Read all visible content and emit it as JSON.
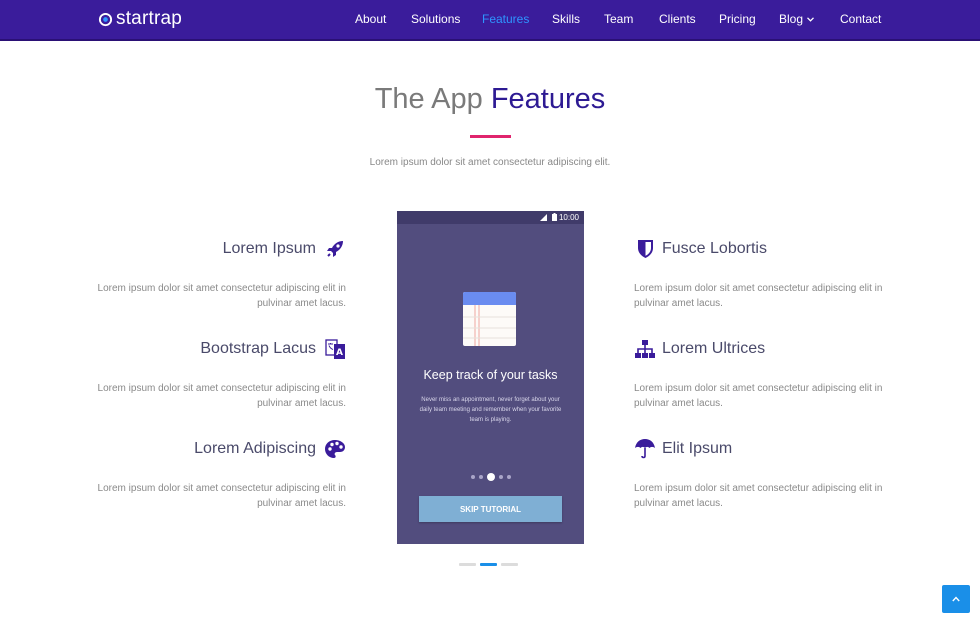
{
  "brand": {
    "name": "startrap"
  },
  "nav": {
    "items": [
      {
        "label": "About",
        "active": false
      },
      {
        "label": "Solutions",
        "active": false
      },
      {
        "label": "Features",
        "active": true
      },
      {
        "label": "Skills",
        "active": false
      },
      {
        "label": "Team",
        "active": false
      },
      {
        "label": "Clients",
        "active": false
      },
      {
        "label": "Pricing",
        "active": false
      },
      {
        "label": "Blog",
        "active": false,
        "dropdown": true
      },
      {
        "label": "Contact",
        "active": false
      }
    ]
  },
  "section": {
    "title_light": "The App",
    "title_strong": "Features",
    "subtitle": "Lorem ipsum dolor sit amet consectetur adipiscing elit."
  },
  "features_left": [
    {
      "title": "Lorem Ipsum",
      "icon": "rocket-icon",
      "desc": "Lorem ipsum dolor sit amet consectetur adipiscing elit in pulvinar amet lacus."
    },
    {
      "title": "Bootstrap Lacus",
      "icon": "translate-icon",
      "desc": "Lorem ipsum dolor sit amet consectetur adipiscing elit in pulvinar amet lacus."
    },
    {
      "title": "Lorem Adipiscing",
      "icon": "palette-icon",
      "desc": "Lorem ipsum dolor sit amet consectetur adipiscing elit in pulvinar amet lacus."
    }
  ],
  "features_right": [
    {
      "title": "Fusce Lobortis",
      "icon": "shield-icon",
      "desc": "Lorem ipsum dolor sit amet consectetur adipiscing elit in pulvinar amet lacus."
    },
    {
      "title": "Lorem Ultrices",
      "icon": "sitemap-icon",
      "desc": "Lorem ipsum dolor sit amet consectetur adipiscing elit in pulvinar amet lacus."
    },
    {
      "title": "Elit Ipsum",
      "icon": "umbrella-icon",
      "desc": "Lorem ipsum dolor sit amet consectetur adipiscing elit in pulvinar amet lacus."
    }
  ],
  "phone": {
    "time": "10:00",
    "title": "Keep track of your tasks",
    "text": "Never miss an appointment, never forget about your daily team meeting and remember when your favorite team is playing.",
    "button": "SKIP TUTORIAL",
    "pages": 5,
    "current_page": 3
  },
  "carousel": {
    "slides": 3,
    "active": 2
  },
  "colors": {
    "header_bg": "#3a1c9b",
    "accent": "#2d1a93",
    "active_nav": "#2f95ff",
    "title_underline": "#e0246d",
    "phone_bg": "#524d7e",
    "button_bg": "#7fafd4",
    "to_top_bg": "#1a8fe8"
  }
}
